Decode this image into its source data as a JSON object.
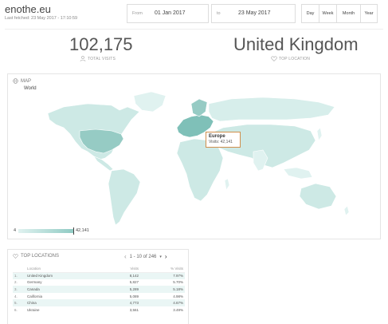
{
  "header": {
    "site_title": "enothe.eu",
    "last_fetched": "Last fetched: 23 May 2017 - 17:10:59"
  },
  "date_range": {
    "from_label": "From",
    "from_value": "01 Jan 2017",
    "to_label": "to",
    "to_value": "23 May 2017"
  },
  "periods": [
    "Day",
    "Week",
    "Month",
    "Year"
  ],
  "stats": {
    "total_visits_value": "102,175",
    "total_visits_label": "TOTAL VISITS",
    "top_location_value": "United Kingdom",
    "top_location_label": "TOP LOCATION"
  },
  "map": {
    "title": "MAP",
    "subtitle": "World",
    "tooltip_title": "Europe",
    "tooltip_body": "Visits: 42,141",
    "legend_min": "4",
    "legend_max": "42,141",
    "colors": {
      "ocean": "#ffffff",
      "low": "#e0f2f0",
      "mid": "#b6dfd9",
      "high": "#7fc0b8",
      "border": "#ffffff",
      "tooltip_border": "#d08f4c"
    },
    "highlighted_region": "Europe"
  },
  "top_locations": {
    "title": "TOP LOCATIONS",
    "pager_text": "1 - 10 of 246",
    "columns": [
      "Location",
      "Visits",
      "% Visits"
    ],
    "rows": [
      {
        "rank": "1.",
        "location": "United Kingdom",
        "visits": "8,142",
        "pct": "7.97%"
      },
      {
        "rank": "2.",
        "location": "Germany",
        "visits": "5,827",
        "pct": "5.70%"
      },
      {
        "rank": "3.",
        "location": "Canada",
        "visits": "5,289",
        "pct": "5.18%"
      },
      {
        "rank": "4.",
        "location": "California",
        "visits": "5,089",
        "pct": "4.98%"
      },
      {
        "rank": "5.",
        "location": "China",
        "visits": "4,773",
        "pct": "4.67%"
      },
      {
        "rank": "6.",
        "location": "Ukraine",
        "visits": "3,561",
        "pct": "3.49%"
      }
    ]
  }
}
